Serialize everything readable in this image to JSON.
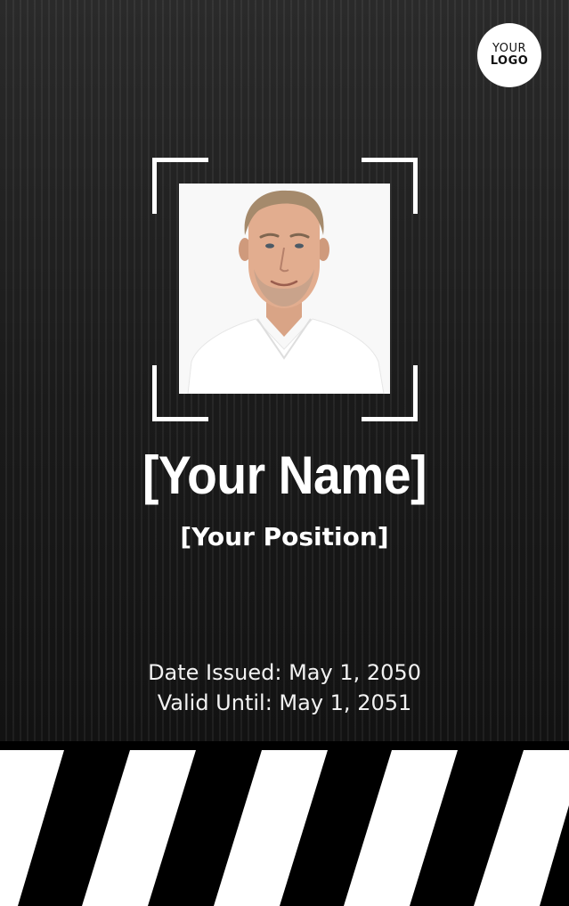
{
  "logo": {
    "line1": "YOUR",
    "line2": "LOGO"
  },
  "photo": {
    "alt": "Portrait of a smiling man in a white t-shirt"
  },
  "card": {
    "name": "[Your Name]",
    "position": "[Your Position]",
    "date_issued": "Date Issued: May 1, 2050",
    "valid_until": "Valid Until: May 1, 2051"
  },
  "colors": {
    "background": "#1b1b1b",
    "accent": "#ffffff",
    "stripe_dark": "#000000",
    "stripe_light": "#ffffff"
  }
}
